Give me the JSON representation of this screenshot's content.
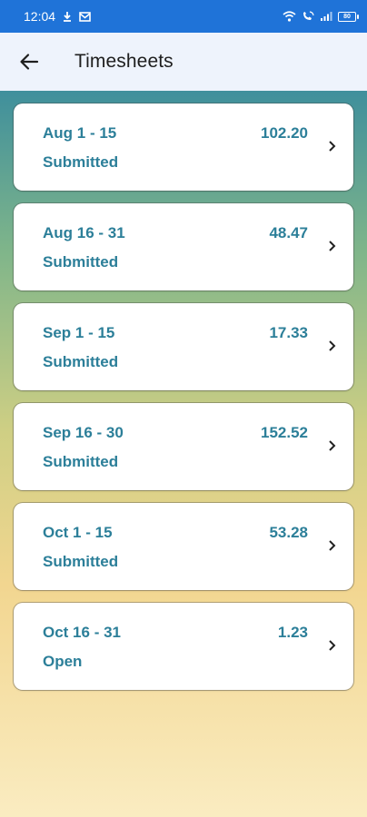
{
  "status_bar": {
    "time": "12:04",
    "left_icons": [
      "download-icon",
      "mail-icon"
    ],
    "right_icons": [
      "wifi-icon",
      "wifi-call-icon",
      "signal-icon",
      "battery-icon"
    ],
    "battery_level": "80"
  },
  "app_bar": {
    "title": "Timesheets",
    "back_icon": "arrow-left-icon"
  },
  "colors": {
    "accent_text": "#2c7f99",
    "status_bar": "#1f73d8",
    "app_bar": "#eef3fc"
  },
  "timesheets": [
    {
      "period": "Aug 1 - 15",
      "hours": "102.20",
      "status": "Submitted"
    },
    {
      "period": "Aug 16 - 31",
      "hours": "48.47",
      "status": "Submitted"
    },
    {
      "period": "Sep 1 - 15",
      "hours": "17.33",
      "status": "Submitted"
    },
    {
      "period": "Sep 16 - 30",
      "hours": "152.52",
      "status": "Submitted"
    },
    {
      "period": "Oct 1 - 15",
      "hours": "53.28",
      "status": "Submitted"
    },
    {
      "period": "Oct 16 - 31",
      "hours": "1.23",
      "status": "Open"
    }
  ]
}
